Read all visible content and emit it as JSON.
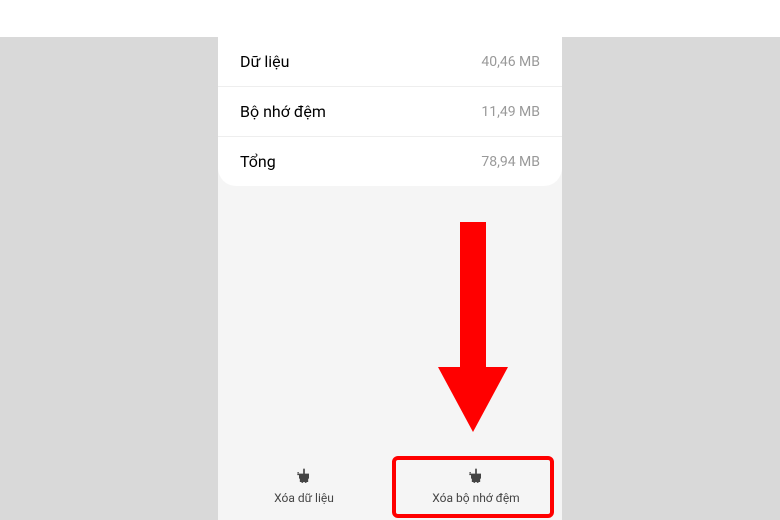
{
  "storage": {
    "rows": [
      {
        "label": "Dữ liệu",
        "value": "40,46 MB"
      },
      {
        "label": "Bộ nhớ đệm",
        "value": "11,49 MB"
      },
      {
        "label": "Tổng",
        "value": "78,94 MB"
      }
    ]
  },
  "actions": {
    "clear_data": "Xóa dữ liệu",
    "clear_cache": "Xóa bộ nhớ đệm"
  },
  "annotation": {
    "highlight_target": "clear-cache-button",
    "arrow_color": "#ff0000"
  }
}
